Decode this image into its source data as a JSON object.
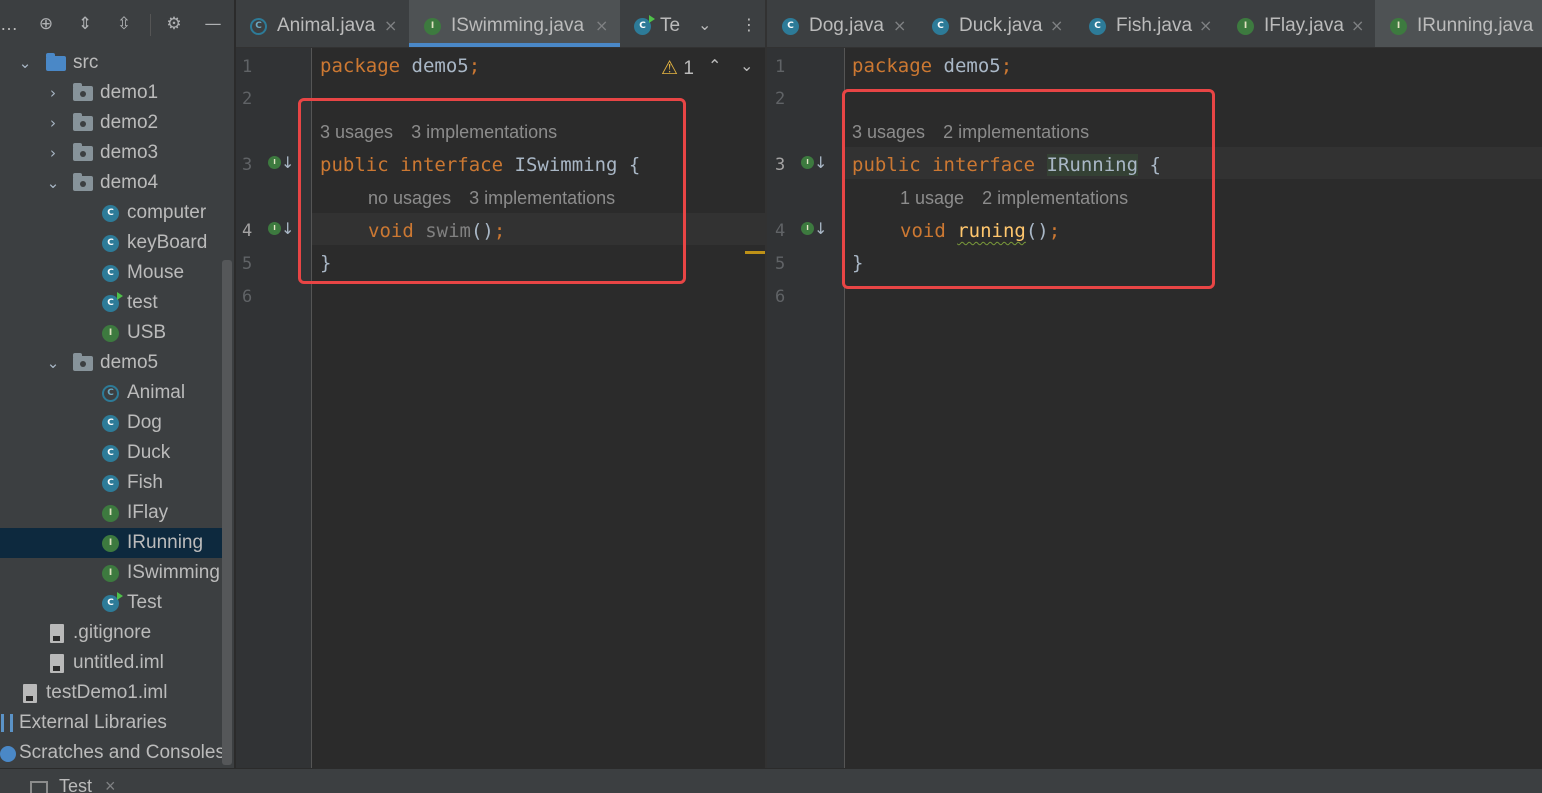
{
  "sidebar": {
    "overflow_label": "…",
    "toolbar_icons": [
      "target-icon",
      "expand-all-icon",
      "collapse-all-icon",
      "gear-icon",
      "minimize-icon"
    ],
    "tree": [
      {
        "label": "src",
        "icon": "source-folder-icon",
        "expanded": true
      },
      {
        "label": "demo1",
        "icon": "package-icon",
        "expanded": false
      },
      {
        "label": "demo2",
        "icon": "package-icon",
        "expanded": false
      },
      {
        "label": "demo3",
        "icon": "package-icon",
        "expanded": false
      },
      {
        "label": "demo4",
        "icon": "package-icon",
        "expanded": true
      },
      {
        "label": "computer",
        "icon": "class-icon"
      },
      {
        "label": "keyBoard",
        "icon": "class-icon"
      },
      {
        "label": "Mouse",
        "icon": "class-icon"
      },
      {
        "label": "test",
        "icon": "runnable-class-icon"
      },
      {
        "label": "USB",
        "icon": "interface-icon"
      },
      {
        "label": "demo5",
        "icon": "package-icon",
        "expanded": true
      },
      {
        "label": "Animal",
        "icon": "abstract-class-icon"
      },
      {
        "label": "Dog",
        "icon": "class-icon"
      },
      {
        "label": "Duck",
        "icon": "class-icon"
      },
      {
        "label": "Fish",
        "icon": "class-icon"
      },
      {
        "label": "IFlay",
        "icon": "interface-icon"
      },
      {
        "label": "IRunning",
        "icon": "interface-icon",
        "selected": true
      },
      {
        "label": "ISwimming",
        "icon": "interface-icon"
      },
      {
        "label": "Test",
        "icon": "runnable-class-icon"
      },
      {
        "label": ".gitignore",
        "icon": "ignore-file-icon"
      },
      {
        "label": "untitled.iml",
        "icon": "module-file-icon"
      },
      {
        "label": "testDemo1.iml",
        "icon": "module-file-icon"
      },
      {
        "label": "External Libraries",
        "icon": "libraries-icon"
      },
      {
        "label": "Scratches and Consoles",
        "icon": "scratches-icon"
      }
    ]
  },
  "left_editor": {
    "tabs": [
      {
        "label": "Animal.java",
        "icon": "abstract-class-icon"
      },
      {
        "label": "ISwimming.java",
        "icon": "interface-icon",
        "active": true
      },
      {
        "label": "Te",
        "icon": "runnable-class-icon"
      }
    ],
    "warning_count": "1",
    "line_numbers": [
      "1",
      "2",
      "3",
      "4",
      "5",
      "6"
    ],
    "code": {
      "l1_kw": "package",
      "l1_rest": " demo5",
      "l1_semi": ";",
      "hint1_usages": "3 usages",
      "hint1_impl": "3 implementations",
      "l3_kw1": "public",
      "l3_kw2": "interface",
      "l3_name": "ISwimming",
      "l3_brace": " {",
      "hint2_usages": "no usages",
      "hint2_impl": "3 implementations",
      "l4_kw": "void",
      "l4_name": "swim",
      "l4_parens": "()",
      "l4_semi": ";",
      "l5": "}"
    }
  },
  "right_editor": {
    "tabs": [
      {
        "label": "Dog.java",
        "icon": "class-icon"
      },
      {
        "label": "Duck.java",
        "icon": "class-icon"
      },
      {
        "label": "Fish.java",
        "icon": "class-icon"
      },
      {
        "label": "IFlay.java",
        "icon": "interface-icon"
      },
      {
        "label": "IRunning.java",
        "icon": "interface-icon",
        "active": true
      }
    ],
    "line_numbers": [
      "1",
      "2",
      "3",
      "4",
      "5",
      "6"
    ],
    "code": {
      "l1_kw": "package",
      "l1_rest": " demo5",
      "l1_semi": ";",
      "hint1_usages": "3 usages",
      "hint1_impl": "2 implementations",
      "l3_kw1": "public",
      "l3_kw2": "interface",
      "l3_name": "IRunning",
      "l3_brace": " {",
      "hint2_usages": "1 usage",
      "hint2_impl": "2 implementations",
      "l4_kw": "void",
      "l4_name": "runing",
      "l4_parens": "()",
      "l4_semi": ";",
      "l5": "}"
    }
  },
  "bottom_bar": {
    "tab_label": "Test",
    "close": "×"
  },
  "colors": {
    "keyword": "#cc7832",
    "method": "#ffc66d",
    "highlight_box": "#e84545",
    "selection": "#0d293e"
  }
}
